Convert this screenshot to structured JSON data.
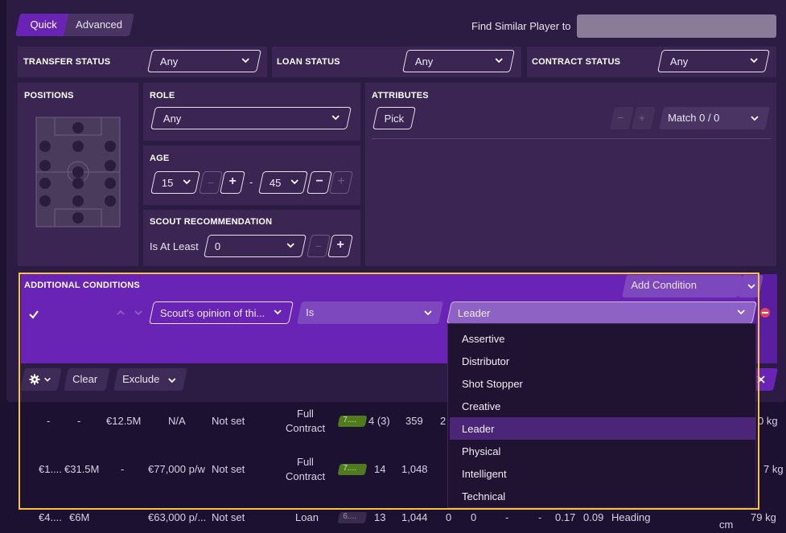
{
  "tabs": {
    "quick": "Quick",
    "advanced": "Advanced"
  },
  "find_similar": {
    "label": "Find Similar Player to",
    "value": ""
  },
  "filters": {
    "transfer_status": {
      "title": "TRANSFER STATUS",
      "value": "Any"
    },
    "loan_status": {
      "title": "LOAN STATUS",
      "value": "Any"
    },
    "contract_status": {
      "title": "CONTRACT STATUS",
      "value": "Any"
    }
  },
  "positions": {
    "title": "POSITIONS"
  },
  "role": {
    "title": "ROLE",
    "value": "Any"
  },
  "age": {
    "title": "AGE",
    "min": "15",
    "max": "45",
    "separator": "-"
  },
  "scout": {
    "title": "SCOUT RECOMMENDATION",
    "label": "Is At Least",
    "value": "0"
  },
  "attributes": {
    "title": "ATTRIBUTES",
    "pick": "Pick",
    "match": "Match 0 / 0"
  },
  "additional": {
    "title": "ADDITIONAL CONDITIONS",
    "add_condition": "Add Condition",
    "condition_field": "Scout's opinion of thi...",
    "condition_operator": "Is",
    "condition_value": "Leader"
  },
  "toolbar": {
    "clear": "Clear",
    "exclude": "Exclude"
  },
  "dropdown_options": [
    "Assertive",
    "Distributor",
    "Shot Stopper",
    "Creative",
    "Leader",
    "Physical",
    "Intelligent",
    "Technical"
  ],
  "dropdown_selected": "Leader",
  "rows": [
    {
      "c1": "-",
      "c2": "-",
      "c3": "€12.5M",
      "c4": "N/A",
      "c5": "Not set",
      "c6a": "Full",
      "c6b": "Contract",
      "badge": "7....",
      "c7": "4 (3)",
      "c8": "359",
      "c9": "2",
      "tail": "0 kg"
    },
    {
      "c1": "€1....",
      "c2": "€31.5M",
      "c3": "-",
      "c4": "€77,000 p/w",
      "c5": "Not set",
      "c6a": "Full",
      "c6b": "Contract",
      "badge": "7....",
      "c7": "14",
      "c8": "1,048",
      "c9": "",
      "tail": "7 kg"
    },
    {
      "c1": "€4....",
      "c2": "€6M",
      "c3": "",
      "c4": "€63,000 p/...",
      "c5": "Not set",
      "c6a": "Loan",
      "c6b": "",
      "badge": "6....",
      "c7": "13",
      "c8": "1,044",
      "c9": "0",
      "c10": "0",
      "c11": "-",
      "c12": "-",
      "c13": "0.17",
      "c14": "0.09",
      "c15": "Heading",
      "tail_top": "cm",
      "tail": "79 kg"
    }
  ],
  "colors": {
    "accent": "#6a24b5",
    "panel": "#3a2553",
    "highlight": "#f5c242",
    "dropdown_selected": "#4b2577"
  }
}
